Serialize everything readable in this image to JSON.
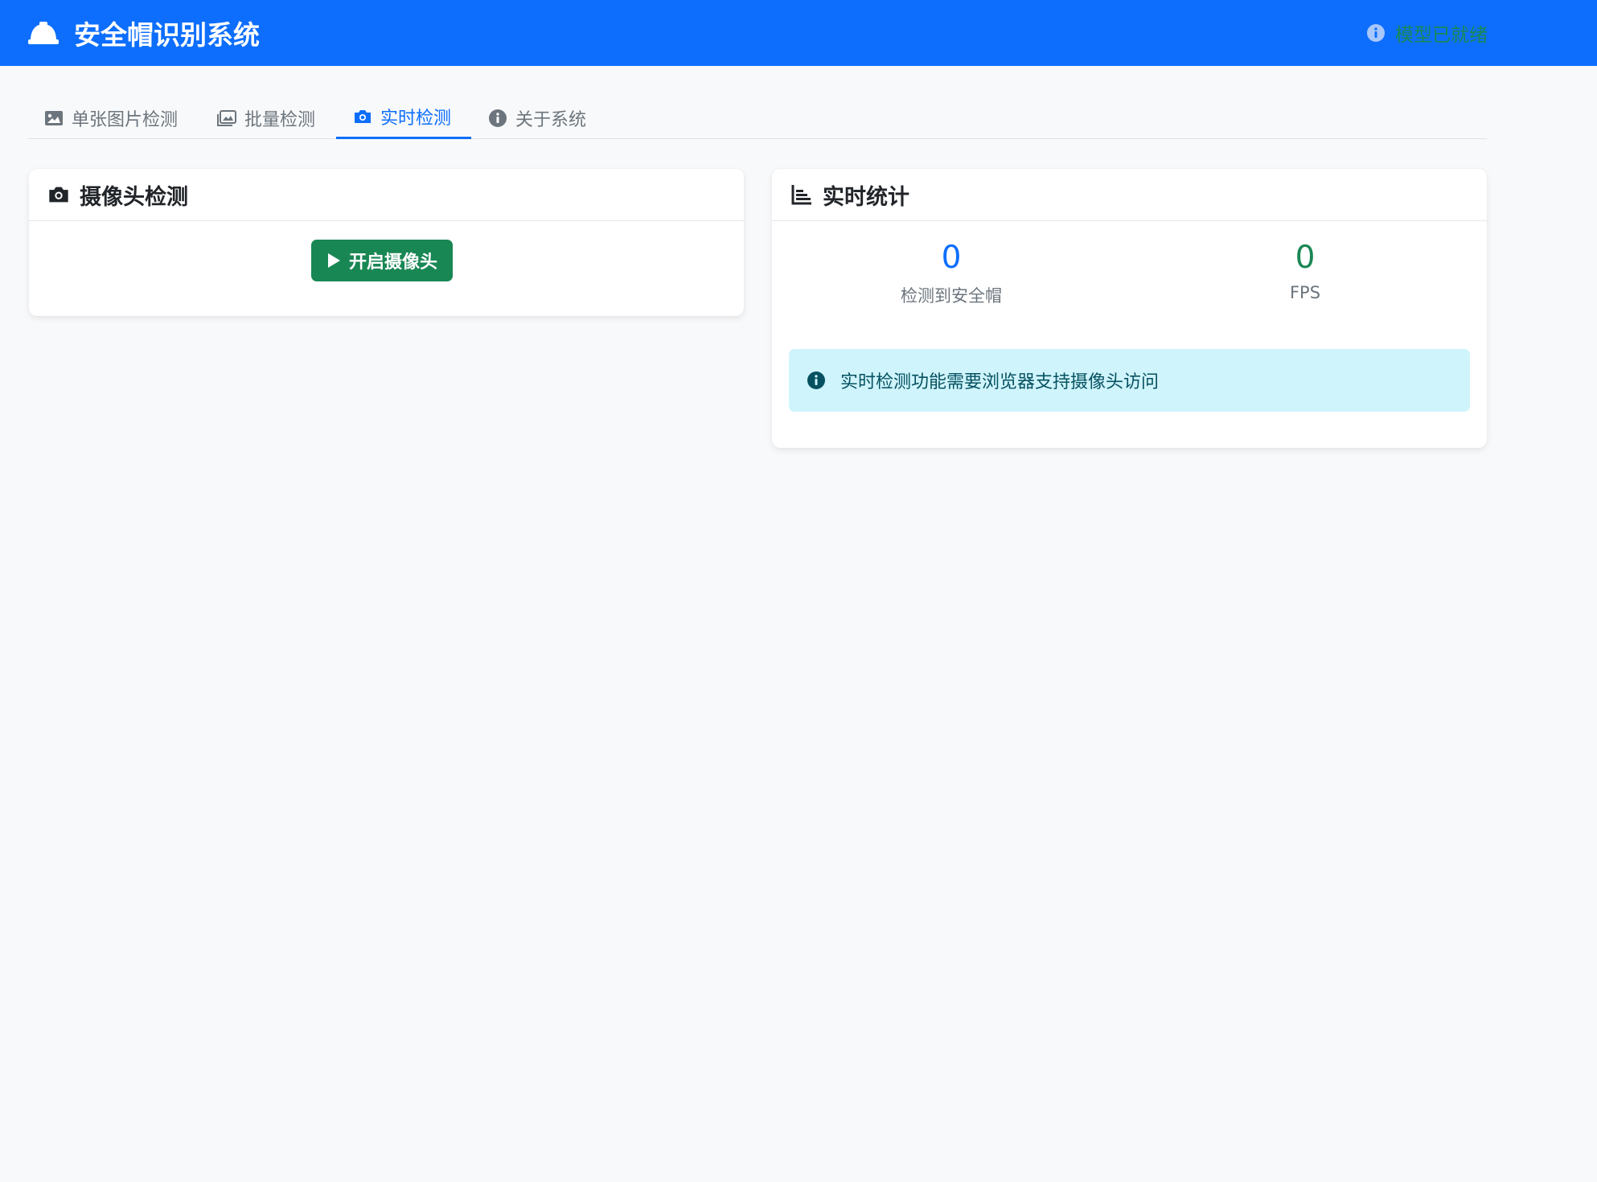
{
  "app": {
    "title": "安全帽识别系统",
    "status": "模型已就绪"
  },
  "tabs": [
    {
      "label": "单张图片检测",
      "icon": "image-icon",
      "active": false
    },
    {
      "label": "批量检测",
      "icon": "images-icon",
      "active": false
    },
    {
      "label": "实时检测",
      "icon": "camera-icon",
      "active": true
    },
    {
      "label": "关于系统",
      "icon": "info-icon",
      "active": false
    }
  ],
  "camera_card": {
    "title": "摄像头检测",
    "start_button": "开启摄像头"
  },
  "stats_card": {
    "title": "实时统计",
    "helmets_value": "0",
    "helmets_label": "检测到安全帽",
    "fps_value": "0",
    "fps_label": "FPS",
    "notice": "实时检测功能需要浏览器支持摄像头访问"
  },
  "colors": {
    "primary": "#0d6efd",
    "success": "#198754",
    "info_bg": "#cff4fc",
    "info_text": "#055160",
    "muted": "#6c757d",
    "page_bg": "#f8f9fa"
  }
}
